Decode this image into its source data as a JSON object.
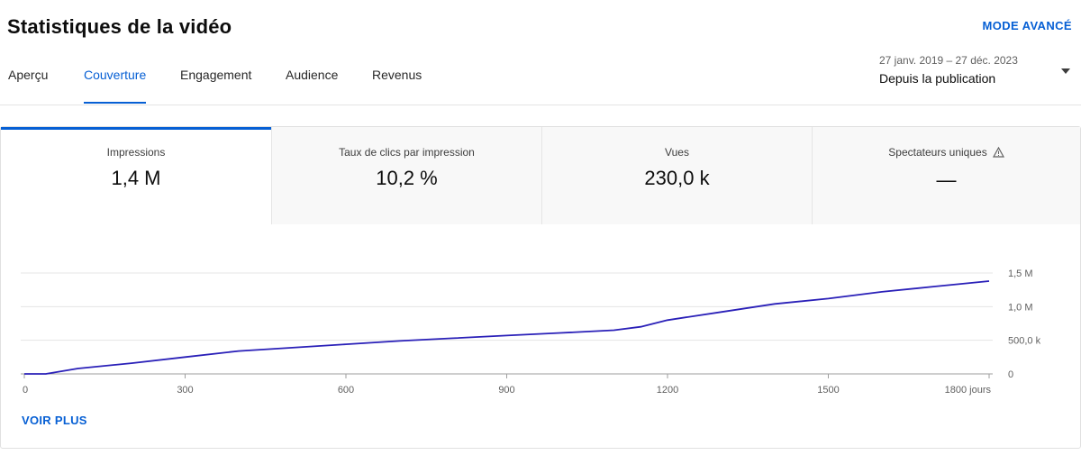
{
  "header": {
    "title": "Statistiques de la vidéo",
    "advanced_mode": "MODE AVANCÉ"
  },
  "tabs": [
    {
      "label": "Aperçu",
      "active": false
    },
    {
      "label": "Couverture",
      "active": true
    },
    {
      "label": "Engagement",
      "active": false
    },
    {
      "label": "Audience",
      "active": false
    },
    {
      "label": "Revenus",
      "active": false
    }
  ],
  "date_selector": {
    "range": "27 janv. 2019 – 27 déc. 2023",
    "label": "Depuis la publication",
    "icon": "caret-down-icon"
  },
  "metrics": [
    {
      "label": "Impressions",
      "value": "1,4 M",
      "active": true
    },
    {
      "label": "Taux de clics par impression",
      "value": "10,2 %",
      "active": false
    },
    {
      "label": "Vues",
      "value": "230,0 k",
      "active": false
    },
    {
      "label": "Spectateurs uniques",
      "value": "—",
      "active": false,
      "icon": "warning-icon"
    }
  ],
  "see_more": "VOIR PLUS",
  "colors": {
    "accent": "#065fd4",
    "line": "#2a20b8"
  },
  "chart_data": {
    "type": "line",
    "title": "",
    "xlabel": "",
    "ylabel": "",
    "xlim": [
      0,
      1800
    ],
    "ylim": [
      0,
      1500000
    ],
    "x_ticks": [
      0,
      300,
      600,
      900,
      1200,
      1500,
      1800
    ],
    "x_tick_labels": [
      "0",
      "300",
      "600",
      "900",
      "1200",
      "1500",
      "1800 jours"
    ],
    "y_ticks": [
      0,
      500000,
      1000000,
      1500000
    ],
    "y_tick_labels": [
      "0",
      "500,0 k",
      "1,0 M",
      "1,5 M"
    ],
    "grid": true,
    "series": [
      {
        "x": [
          0,
          40,
          100,
          200,
          300,
          400,
          500,
          600,
          700,
          800,
          900,
          1000,
          1100,
          1150,
          1200,
          1300,
          1400,
          1500,
          1600,
          1700,
          1800
        ],
        "values": [
          0,
          0,
          80000,
          160000,
          250000,
          340000,
          390000,
          440000,
          490000,
          530000,
          570000,
          610000,
          650000,
          700000,
          800000,
          920000,
          1040000,
          1120000,
          1220000,
          1300000,
          1380000
        ]
      }
    ]
  }
}
